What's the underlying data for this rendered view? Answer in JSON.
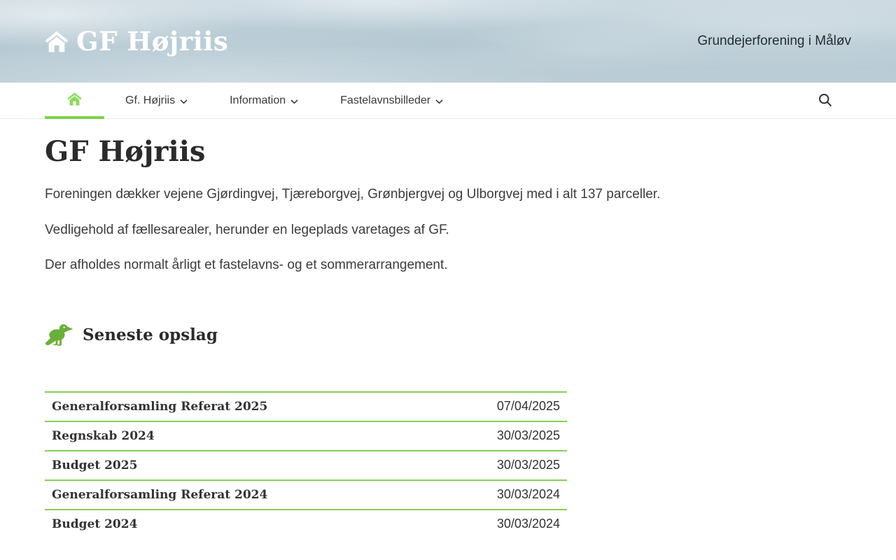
{
  "header": {
    "site_title": "GF Højriis",
    "tagline": "Grundejerforening i Måløv"
  },
  "nav": {
    "items": [
      {
        "label": "",
        "icon": "house-icon",
        "active": true
      },
      {
        "label": "Gf. Højriis",
        "icon": "chevron-down-icon"
      },
      {
        "label": "Information",
        "icon": "chevron-down-icon"
      },
      {
        "label": "Fastelavnsbilleder",
        "icon": "chevron-down-icon"
      }
    ],
    "search_icon": "magnifier-icon"
  },
  "main": {
    "title": "GF Højriis",
    "paragraphs": [
      "Foreningen dækker vejene Gjørdingvej, Tjæreborgvej, Grønbjergvej og Ulborgvej med i alt 137 parceller.",
      "Vedligehold af fællesarealer, herunder en legeplads varetages af GF.",
      "Der afholdes normalt årligt et fastelavns- og et sommerarrangement."
    ],
    "latest_posts": {
      "heading": "Seneste opslag",
      "icon": "crow-icon",
      "posts": [
        {
          "title": "Generalforsamling Referat 2025",
          "date": "07/04/2025"
        },
        {
          "title": "Regnskab 2024",
          "date": "30/03/2025"
        },
        {
          "title": "Budget 2025",
          "date": "30/03/2025"
        },
        {
          "title": "Generalforsamling Referat 2024",
          "date": "30/03/2024"
        },
        {
          "title": "Budget 2024",
          "date": "30/03/2024"
        }
      ]
    }
  },
  "colors": {
    "accent_green": "#6aaf3a",
    "underline_green": "#7cd34a",
    "border_green": "#86cf55",
    "nav_home_green": "#8cd95f",
    "sky_base": "#b7c9d3"
  }
}
